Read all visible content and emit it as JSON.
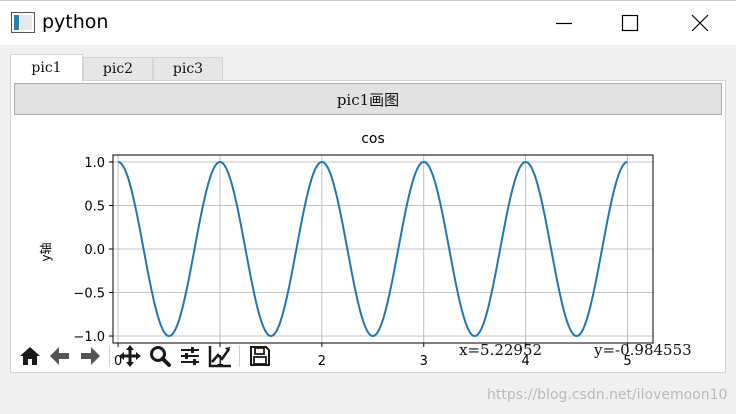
{
  "window": {
    "title": "python"
  },
  "tabs": [
    {
      "label": "pic1"
    },
    {
      "label": "pic2"
    },
    {
      "label": "pic3"
    }
  ],
  "panel": {
    "button_label": "pic1画图"
  },
  "chart_data": {
    "type": "line",
    "title": "cos",
    "xlabel": "",
    "ylabel": "y轴",
    "xlim": [
      -0.05,
      5.25
    ],
    "ylim": [
      -1.08,
      1.08
    ],
    "xticks": [
      0,
      1,
      2,
      3,
      4,
      5
    ],
    "yticks": [
      1.0,
      0.5,
      0.0,
      -0.5,
      -1.0
    ],
    "ytick_labels": [
      "1.0",
      "0.5",
      "0.0",
      "−0.5",
      "−1.0"
    ],
    "grid": true,
    "color": "#1f77b4",
    "series": [
      {
        "function": "cos(2*pi*x)",
        "x_range": [
          0,
          5
        ]
      }
    ]
  },
  "toolbar": {
    "icons": [
      "home-icon",
      "back-arrow-icon",
      "forward-arrow-icon",
      "pan-icon",
      "zoom-icon",
      "subplots-icon",
      "axes-edit-icon",
      "save-icon"
    ],
    "coord_x": "x=5.22952",
    "coord_y": "y=-0.984553"
  },
  "watermark": "https://blog.csdn.net/ilovemoon10"
}
